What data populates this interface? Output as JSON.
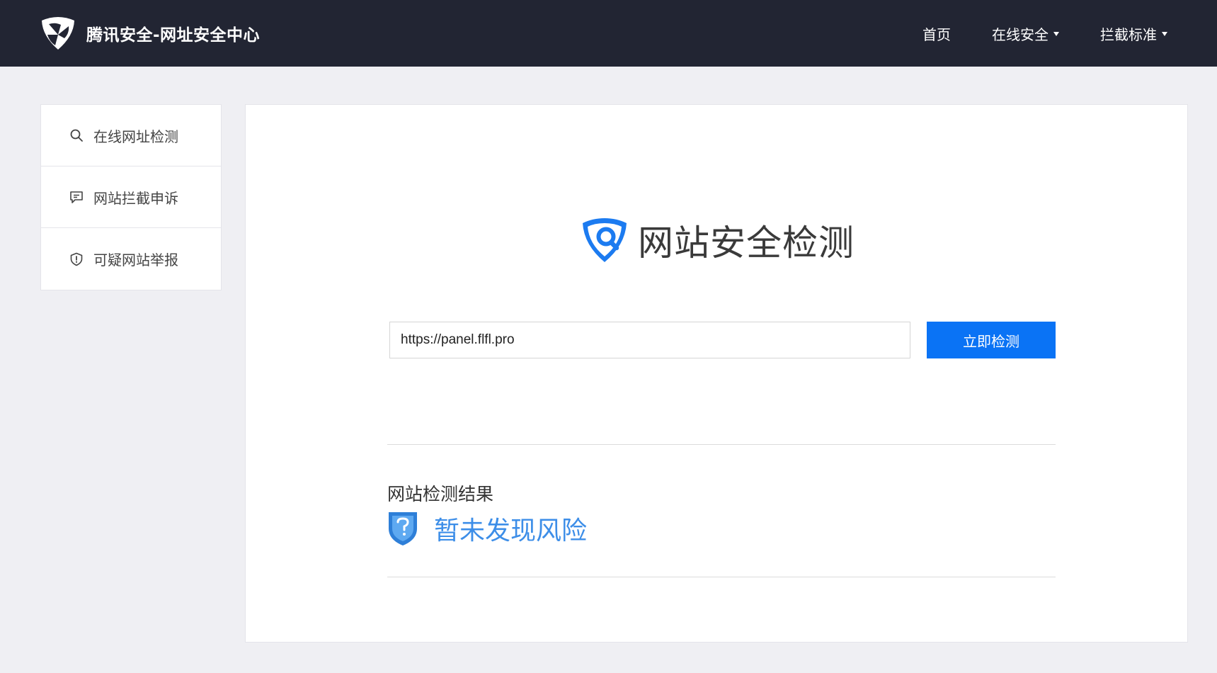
{
  "header": {
    "title": "腾讯安全-网址安全中心",
    "logo_icon": "tencent-security-logo",
    "nav": [
      {
        "label": "首页",
        "has_dropdown": false
      },
      {
        "label": "在线安全",
        "has_dropdown": true
      },
      {
        "label": "拦截标准",
        "has_dropdown": true
      }
    ]
  },
  "sidebar": {
    "items": [
      {
        "label": "在线网址检测",
        "icon": "search-icon"
      },
      {
        "label": "网站拦截申诉",
        "icon": "message-icon"
      },
      {
        "label": "可疑网站举报",
        "icon": "shield-alert-icon"
      }
    ]
  },
  "main": {
    "hero_title": "网站安全检测",
    "url_value": "https://panel.flfl.pro",
    "check_button": "立即检测",
    "result_label": "网站检测结果",
    "result_status": "暂未发现风险"
  },
  "colors": {
    "header_bg": "#222533",
    "accent": "#0a73f5",
    "result_text": "#3d8ee8",
    "page_bg": "#efeff3"
  }
}
